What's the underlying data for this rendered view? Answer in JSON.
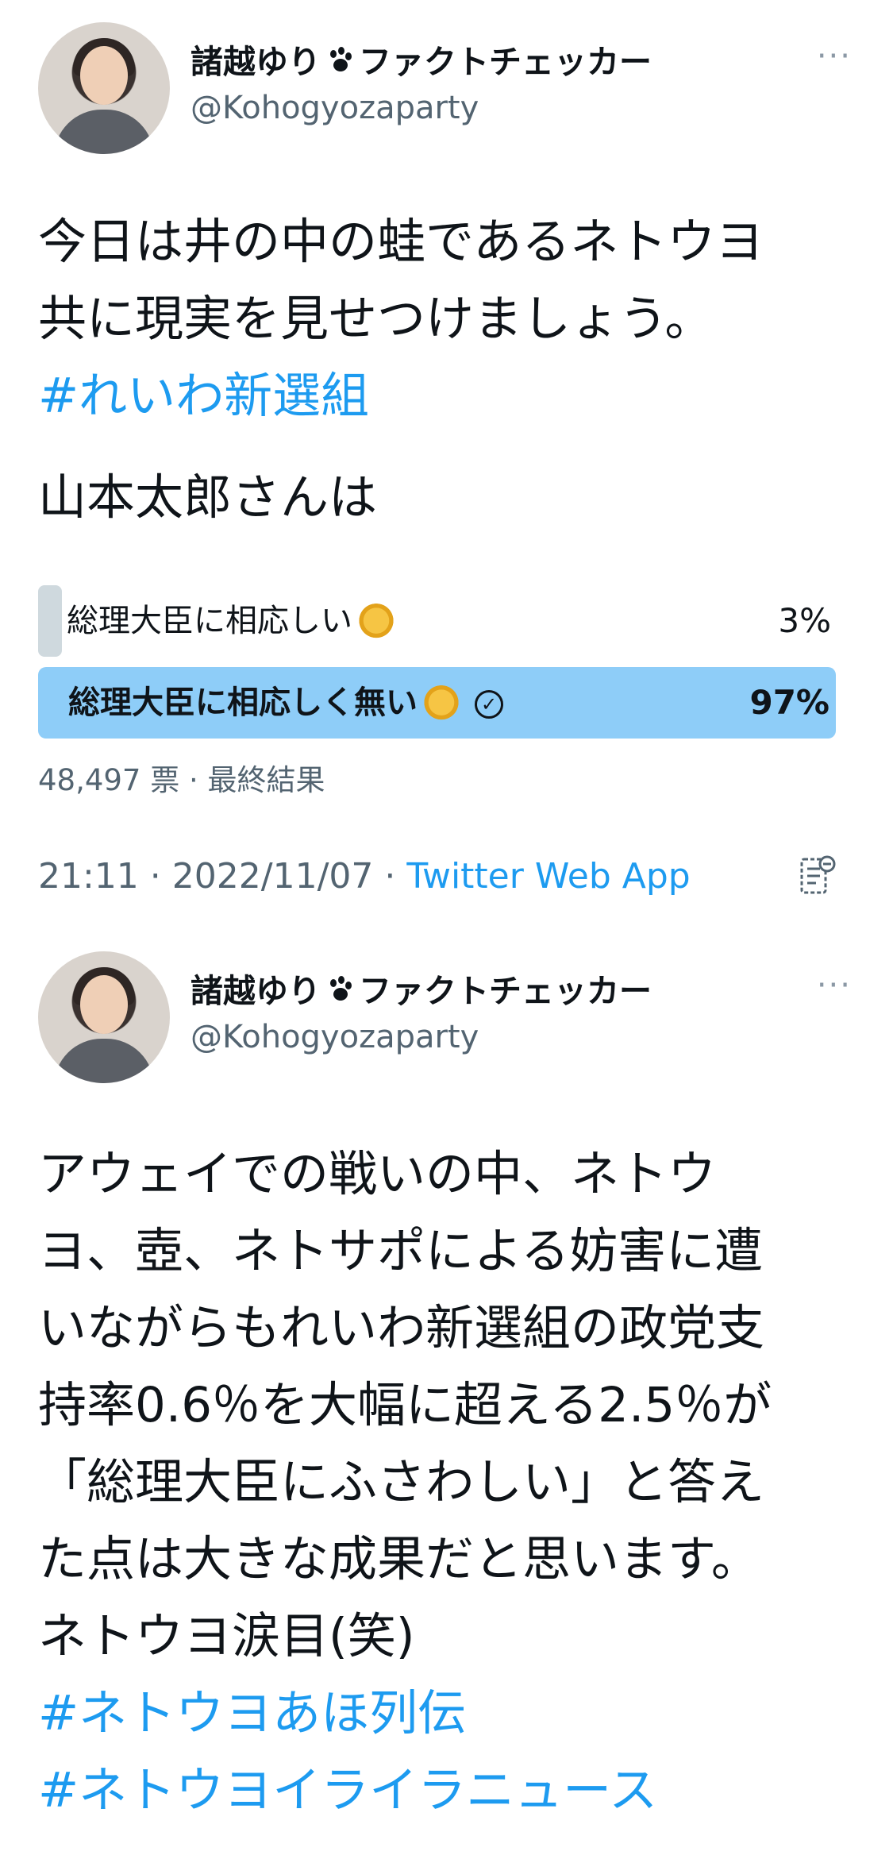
{
  "tweets": [
    {
      "display_name_pre": "諸越ゆり",
      "display_name_post": "ファクトチェッカー",
      "handle": "@Kohogyozaparty",
      "more": "···",
      "lines": [
        "今日は井の中の蛙であるネトウヨ",
        "共に現実を見せつけましょう。"
      ],
      "hashtag": "#れいわ新選組",
      "question": "山本太郎さんは",
      "poll": {
        "options": [
          {
            "label": "総理大臣に相応しい",
            "percent": "3%",
            "value": 3,
            "winner": false
          },
          {
            "label": "総理大臣に相応しく無い",
            "percent": "97%",
            "value": 97,
            "winner": true
          }
        ],
        "votes": "48,497 票",
        "status": "最終結果"
      },
      "time": "21:11",
      "date": "2022/11/07",
      "app": "Twitter Web App"
    },
    {
      "display_name_pre": "諸越ゆり",
      "display_name_post": "ファクトチェッカー",
      "handle": "@Kohogyozaparty",
      "more": "···",
      "lines": [
        "アウェイでの戦いの中、ネトウ",
        "ヨ、壺、ネトサポによる妨害に遭",
        "いながらもれいわ新選組の政党支",
        "持率0.6％を大幅に超える2.5％が",
        "「総理大臣にふさわしい」と答え",
        "た点は大きな成果だと思います。",
        "ネトウヨ涙目(笑)"
      ],
      "hashtags": [
        "#ネトウヨあほ列伝",
        "#ネトウヨイライラニュース"
      ]
    }
  ],
  "colors": {
    "accent": "#1d9bf0",
    "poll_winner": "#8ecdf8",
    "poll_loser": "#cfd9de",
    "secondary_text": "#536471"
  },
  "icons": {
    "paw": "paw-prints-icon",
    "more": "more-options-icon",
    "analytics": "analytics-icon",
    "check": "check-circle-icon"
  }
}
